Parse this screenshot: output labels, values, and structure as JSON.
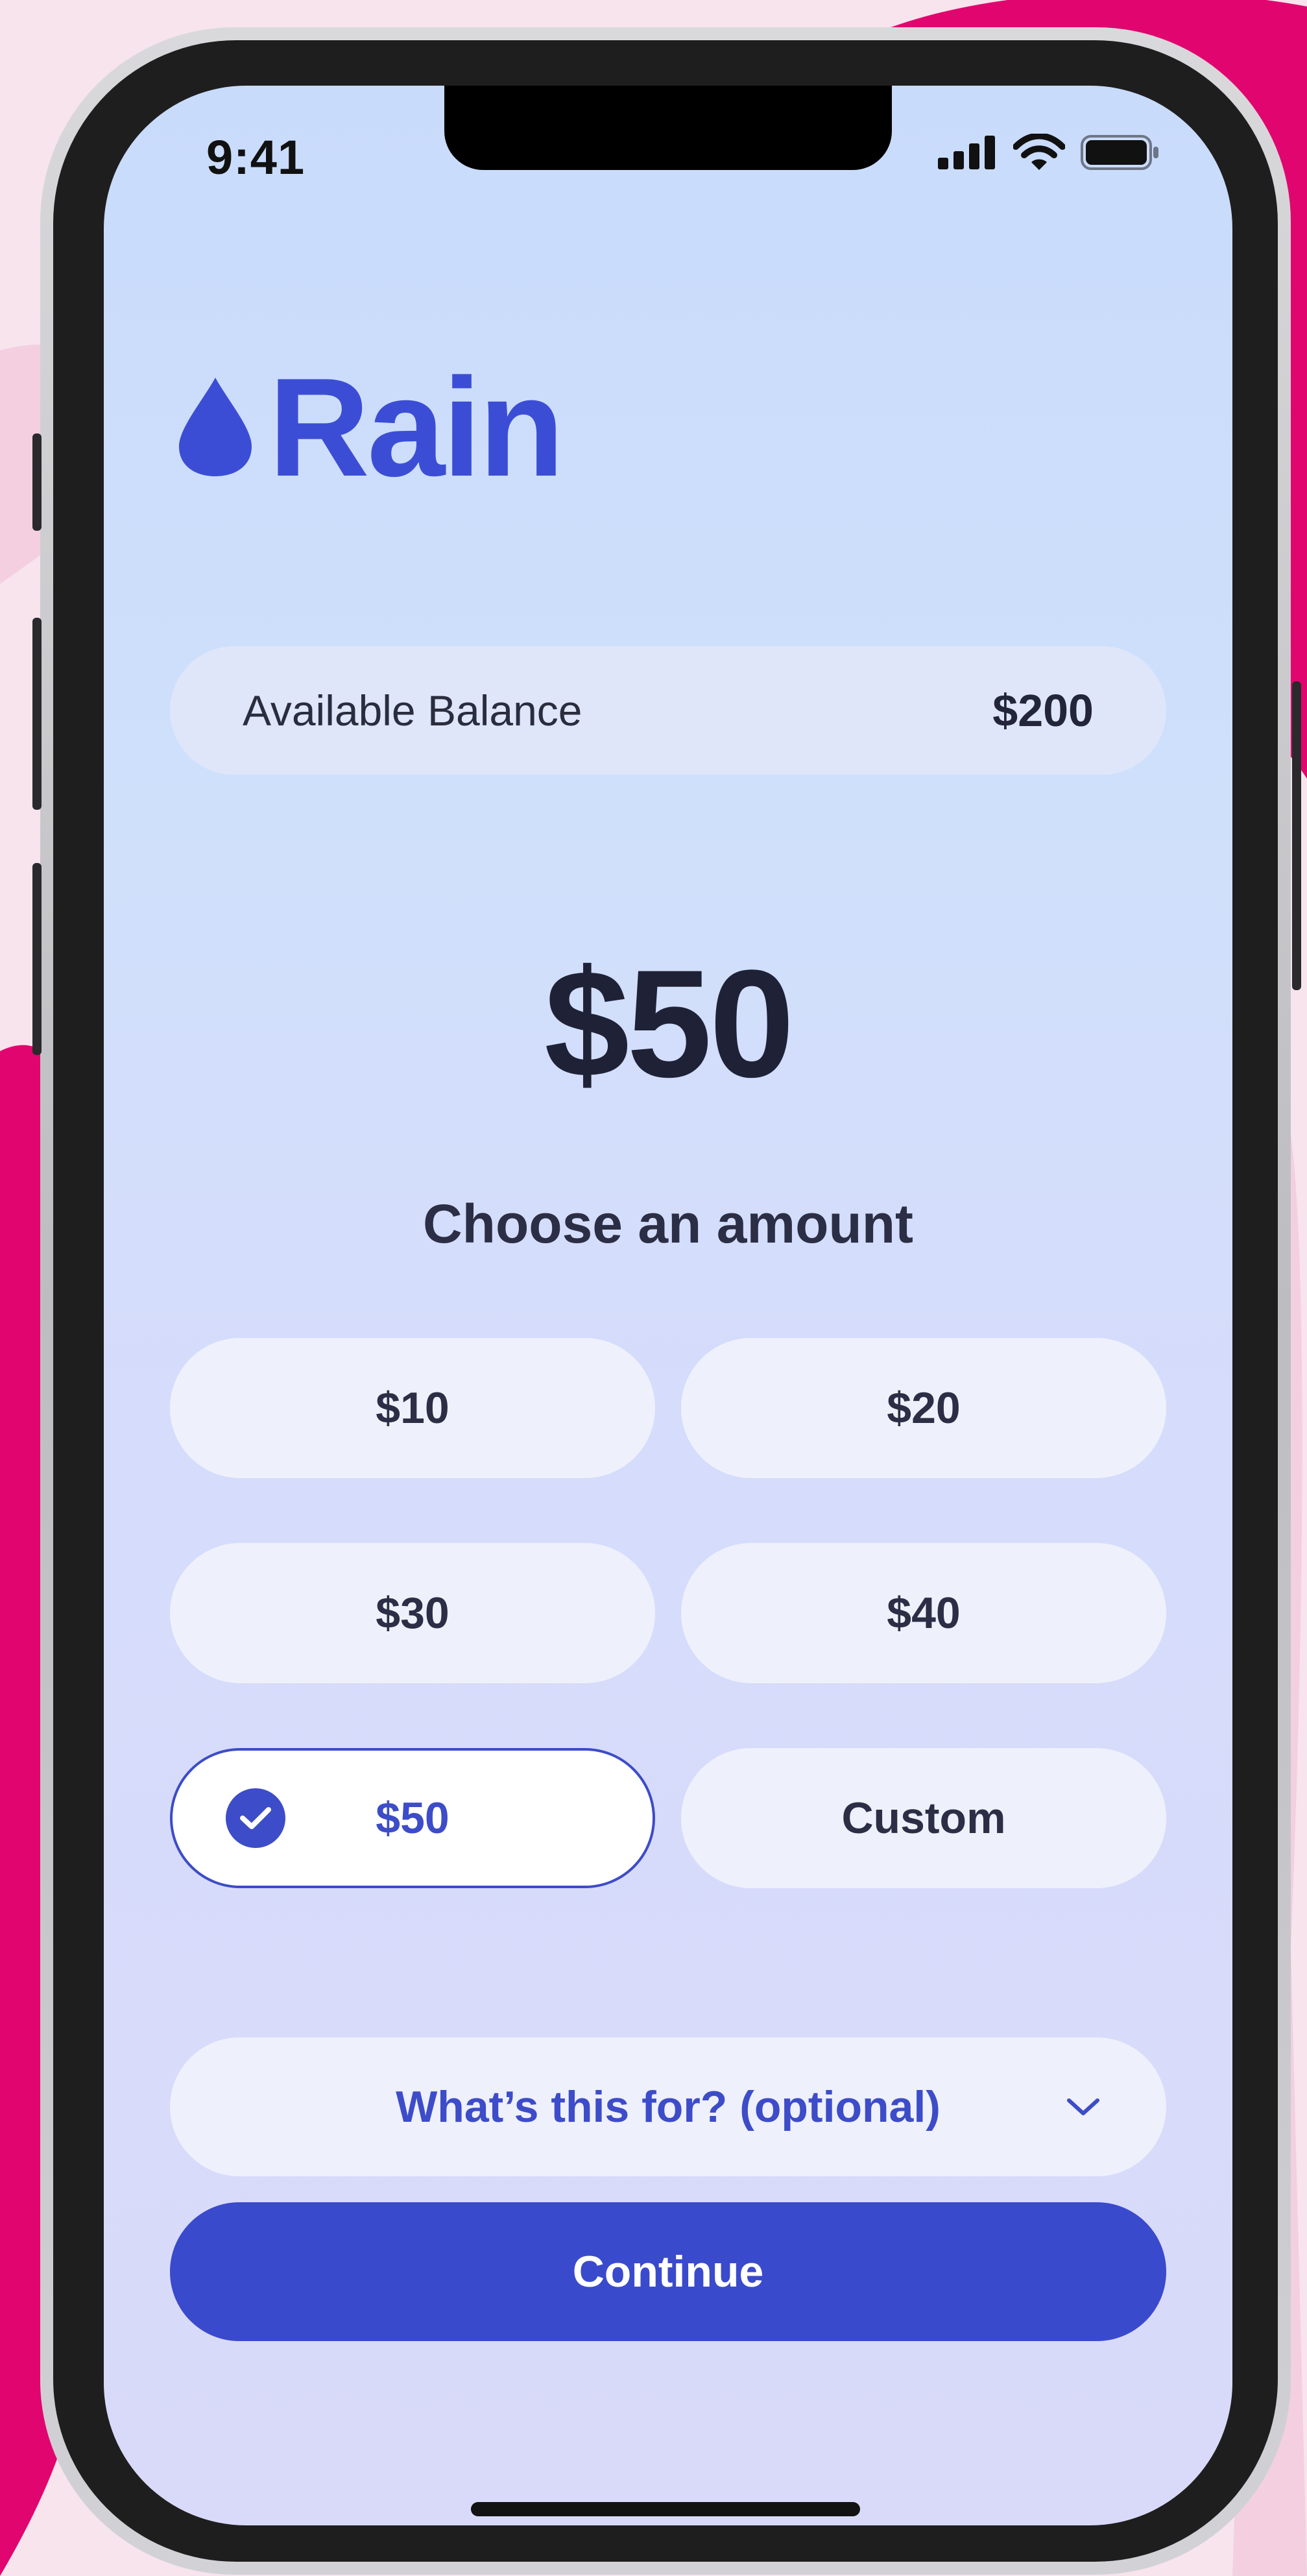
{
  "status_bar": {
    "time": "9:41"
  },
  "brand": {
    "name": "Rain",
    "color": "#3c4dd5",
    "icon": "raindrop-icon"
  },
  "balance": {
    "label": "Available Balance",
    "value": "$200"
  },
  "selected_amount": "$50",
  "choose_label": "Choose an amount",
  "amount_options": [
    {
      "label": "$10",
      "selected": false
    },
    {
      "label": "$20",
      "selected": false
    },
    {
      "label": "$30",
      "selected": false
    },
    {
      "label": "$40",
      "selected": false
    },
    {
      "label": "$50",
      "selected": true
    },
    {
      "label": "Custom",
      "selected": false
    }
  ],
  "purpose": {
    "placeholder": "What’s this for? (optional)",
    "icon": "chevron-down-icon"
  },
  "continue_label": "Continue",
  "colors": {
    "accent": "#3a4acc",
    "background_magenta": "#e1066f"
  }
}
